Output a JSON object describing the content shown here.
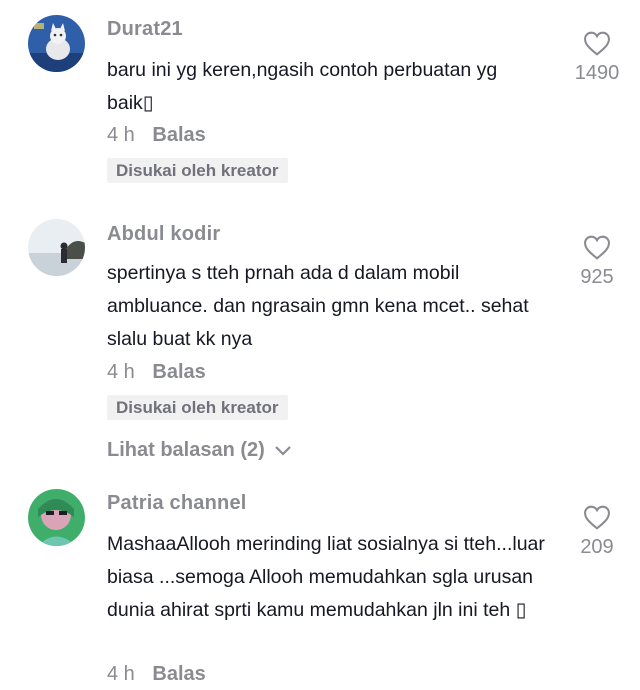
{
  "comments": [
    {
      "username": "Durat21",
      "text": "baru ini yg keren,ngasih contoh perbuatan yg baik▯",
      "time": "4 h",
      "reply_label": "Balas",
      "badge": "Disukai oleh kreator",
      "likes": "1490",
      "avatar_icon": "cat-avatar-icon"
    },
    {
      "username": "Abdul kodir",
      "text": "spertinya s tteh prnah ada d dalam mobil ambluance. dan ngrasain gmn kena mcet.. sehat slalu buat kk nya",
      "time": "4 h",
      "reply_label": "Balas",
      "badge": "Disukai oleh kreator",
      "likes": "925",
      "view_replies": "Lihat balasan (2)",
      "avatar_icon": "landscape-avatar-icon"
    },
    {
      "username": "Patria channel",
      "text": "MashaaAllooh merinding liat sosialnya si tteh...luar biasa ...semoga Allooh memudahkan sgla urusan dunia ahirat sprti kamu memudahkan jln ini teh ▯",
      "time": "4 h",
      "reply_label": "Balas",
      "likes": "209",
      "avatar_icon": "person-avatar-icon"
    }
  ],
  "colors": {
    "muted": "#8a8b91",
    "text": "#161823",
    "badge_bg": "#f1f1f2"
  }
}
